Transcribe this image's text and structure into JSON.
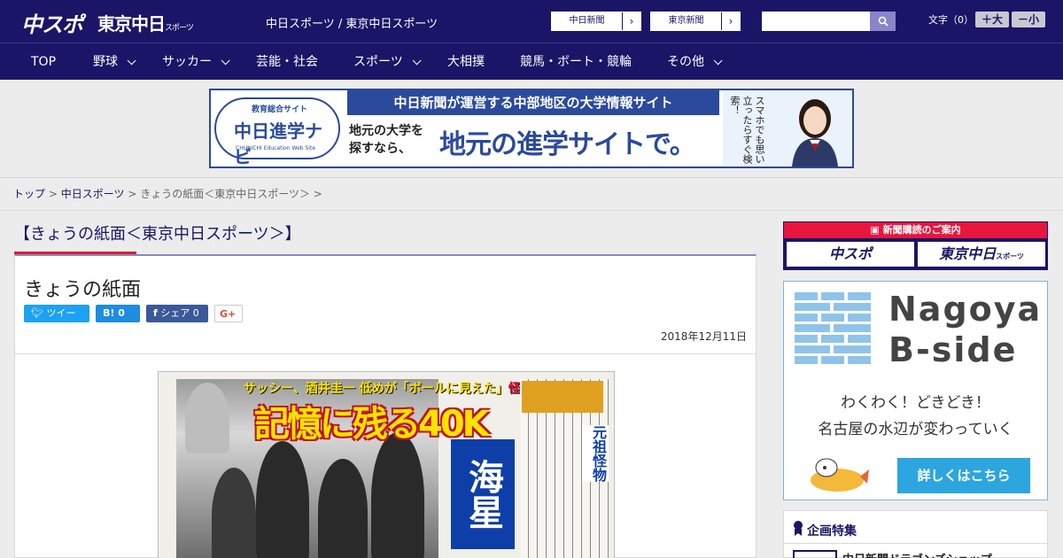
{
  "header": {
    "logo_chusp": "中スポ",
    "logo_tokyo": "東京中日",
    "logo_tokyo_sub": "スポーツ",
    "site_name": "中日スポーツ / 東京中日スポーツ",
    "ext_links": [
      "中日新聞",
      "東京新聞"
    ],
    "search_placeholder": "",
    "fontsize_label": "文字（0）",
    "fontsize_up": "＋大",
    "fontsize_down": "－小"
  },
  "nav": {
    "items": [
      {
        "label": "TOP"
      },
      {
        "label": "野球"
      },
      {
        "label": "サッカー"
      },
      {
        "label": "芸能・社会"
      },
      {
        "label": "スポーツ"
      },
      {
        "label": "大相撲"
      },
      {
        "label": "競馬・ボート・競輪"
      },
      {
        "label": "その他"
      }
    ]
  },
  "banner": {
    "logo_small": "教育総合サイト",
    "logo_big": "中日進学ナビ",
    "logo_en": "CHUNICHI Education Web Site",
    "headline": "中日新聞が運営する中部地区の大学情報サイト",
    "sub_line1": "地元の大学を",
    "sub_line2": "探すなら、",
    "main": "地元の進学サイトで。",
    "side_vertical": "スマホでも思い立ったらすぐ検索！"
  },
  "breadcrumb": {
    "home": "トップ",
    "section": "中日スポーツ",
    "current": "きょうの紙面＜東京中日スポーツ＞"
  },
  "article": {
    "page_heading": "【きょうの紙面＜東京中日スポーツ＞】",
    "title": "きょうの紙面",
    "share": {
      "tweet": "ツイート",
      "hatena": "B! 0",
      "facebook": "シェア 0",
      "gplus": "G+"
    },
    "date": "2018年12月11日",
    "paper": {
      "red_line": "サッシー、酒井圭一 低めが「ボールに見えた」",
      "red_line_accent": "怪速球",
      "headline": "記憶に残る40K",
      "blue_block": "海星",
      "side_title": "元祖怪物"
    }
  },
  "sidebar": {
    "subscribe": {
      "head": "新聞購読のご案内",
      "btn1": "中スポ",
      "btn2": "東京中日",
      "btn2_sub": "スポーツ"
    },
    "bside": {
      "brand_line1": "Nagoya",
      "brand_line2": "B-side",
      "copy1": "わくわく！どきどき！",
      "copy2": "名古屋の水辺が変わっていく",
      "more": "詳しくはこちら"
    },
    "feature": {
      "title": "企画特集",
      "item": "中日新聞ドラゴンズショップ"
    }
  },
  "colors": {
    "brand_navy": "#1a1567",
    "accent_red": "#d9232e",
    "twitter": "#1da1f2",
    "hatena": "#1e8ce0",
    "facebook": "#3b5998"
  }
}
